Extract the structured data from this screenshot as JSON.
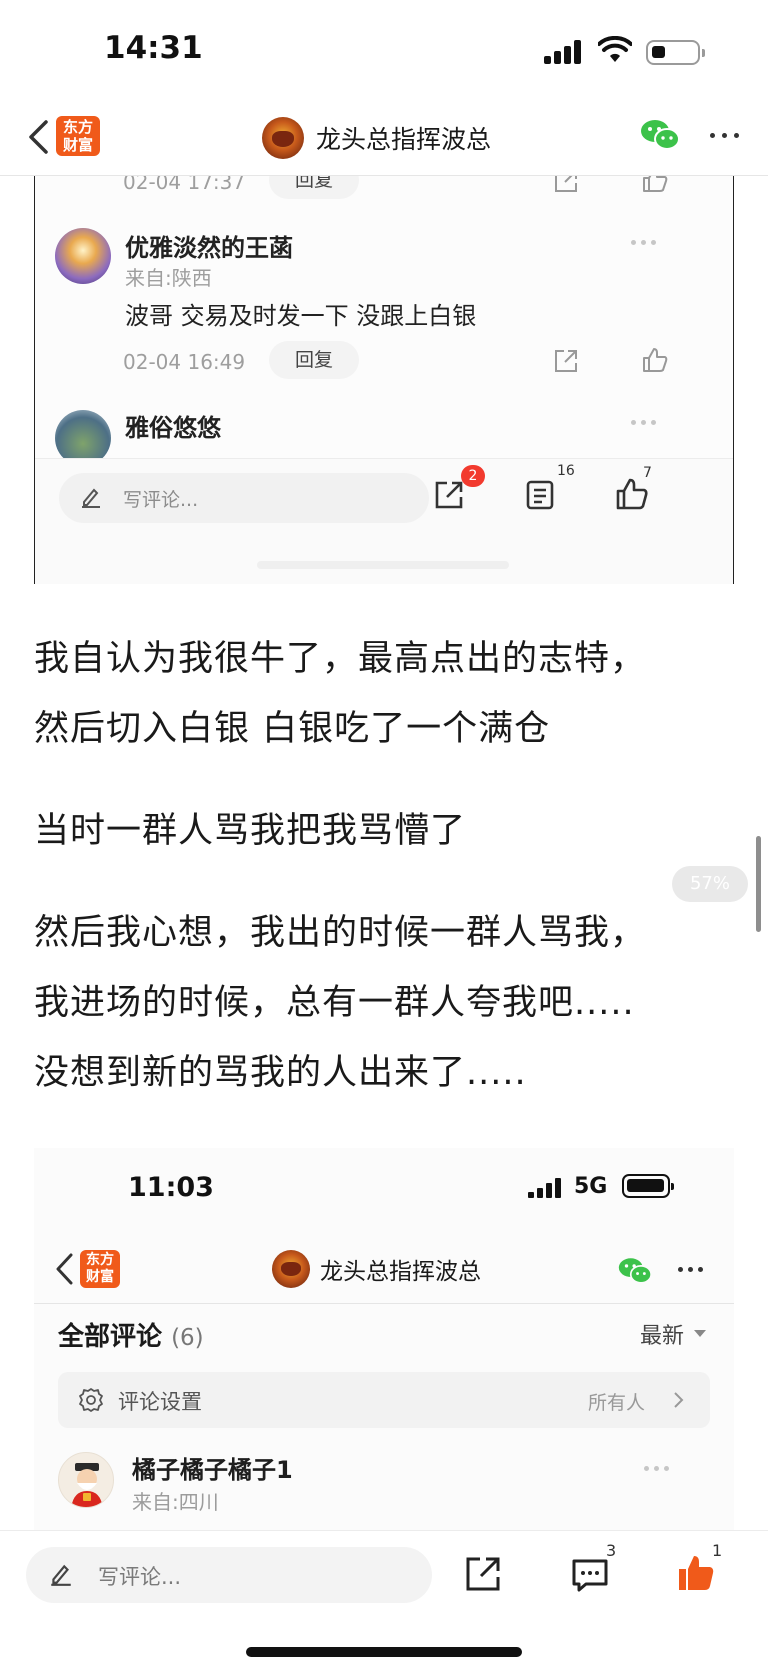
{
  "status_bar": {
    "time": "14:31"
  },
  "nav": {
    "logo_text": "东方财富",
    "logo_line1": "东方",
    "logo_line2": "财富",
    "title": "龙头总指挥波总"
  },
  "embedded_shot_1": {
    "top_comment_meta": {
      "time": "02-04 17:37",
      "reply_label": "回复"
    },
    "comments": [
      {
        "name": "优雅淡然的王菡",
        "from": "来自:陕西",
        "text": "波哥 交易及时发一下 没跟上白银",
        "time": "02-04 16:49",
        "reply_label": "回复"
      },
      {
        "name": "雅俗悠悠"
      }
    ],
    "bottom_bar": {
      "placeholder": "写评论...",
      "share_badge": "2",
      "list_count": "16",
      "like_count": "7"
    }
  },
  "article": {
    "para1_line1": "我自认为我很牛了，最高点出的志特，",
    "para1_line2": "然后切入白银 白银吃了一个满仓",
    "para2": "当时一群人骂我把我骂懵了",
    "para3_line1": "然后我心想，我出的时候一群人骂我，",
    "para3_line2": "我进场的时候，总有一群人夸我吧.....",
    "para3_line3": "没想到新的骂我的人出来了.....",
    "reading_progress": "57%"
  },
  "embedded_shot_2": {
    "status_time": "11:03",
    "network": "5G",
    "logo_line1": "东方",
    "logo_line2": "财富",
    "title": "龙头总指挥波总",
    "section_title": "全部评论",
    "section_count": "(6)",
    "sort_label": "最新",
    "settings_label": "评论设置",
    "settings_value": "所有人",
    "comment": {
      "name": "橘子橘子橘子1",
      "from": "来自:四川"
    }
  },
  "bottom_bar": {
    "placeholder": "写评论...",
    "comment_count": "3",
    "like_count": "1"
  },
  "colors": {
    "brand_orange": "#f05a1a",
    "like_active": "#f05a1a",
    "badge_red": "#f23a2e",
    "wechat_green": "#3cc24a"
  }
}
